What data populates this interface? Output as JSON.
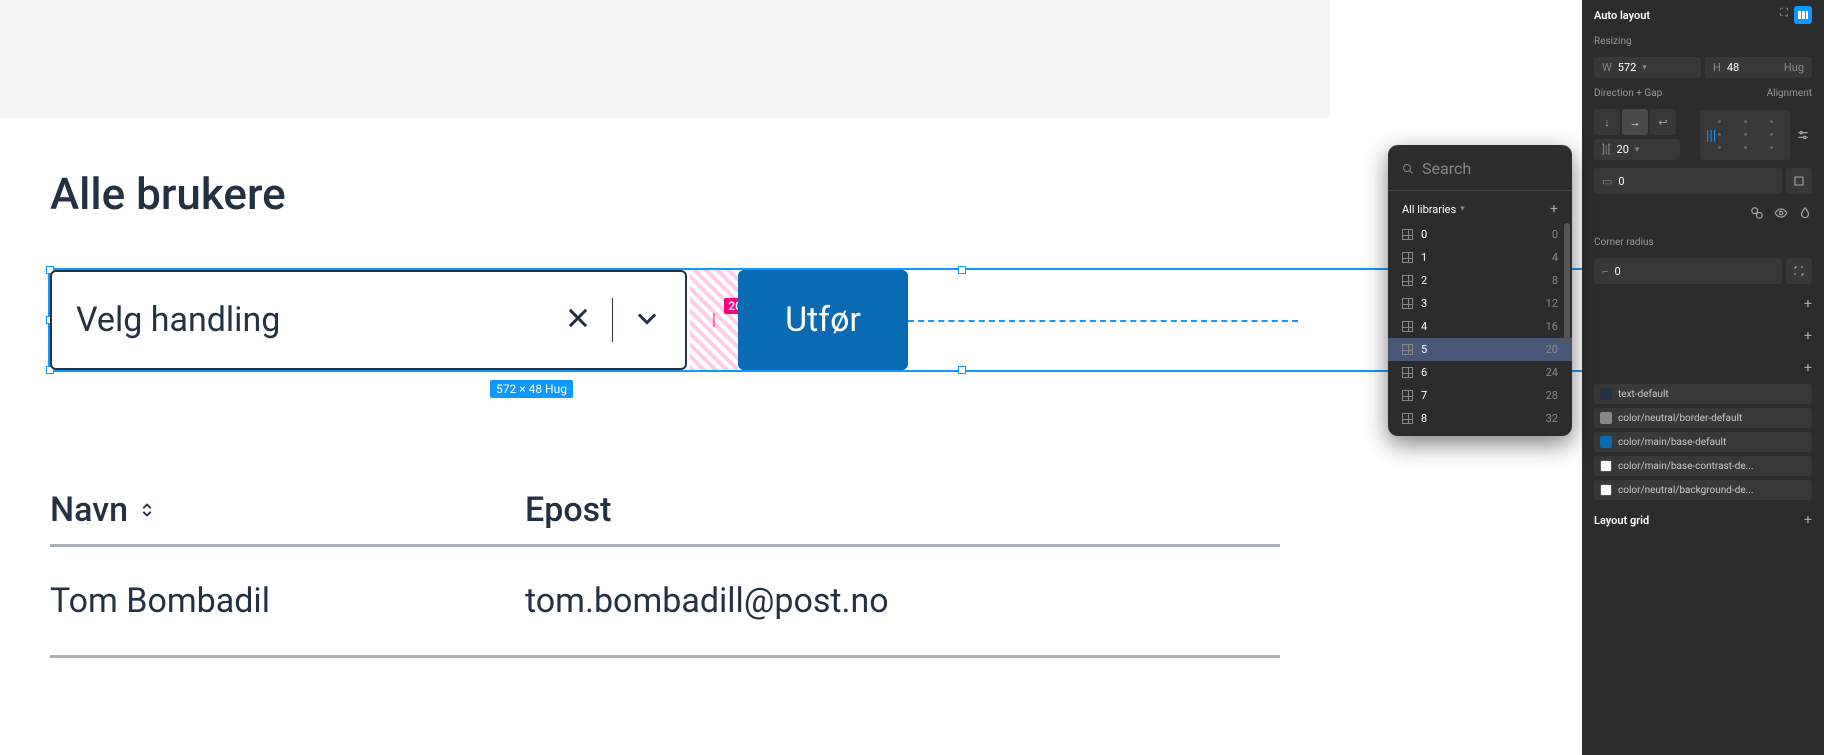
{
  "canvas": {
    "page_title": "Alle brukere",
    "dropdown_label": "Velg handling",
    "spacing_value": "20",
    "exec_button": "Utfør",
    "size_label": "572 × 48 Hug",
    "table": {
      "col_navn": "Navn",
      "col_epost": "Epost",
      "row1_name": "Tom Bombadil",
      "row1_email": "tom.bombadill@post.no"
    }
  },
  "panel": {
    "auto_layout": "Auto layout",
    "resizing": "Resizing",
    "w_label": "W",
    "w_value": "572",
    "h_label": "H",
    "h_value": "48",
    "h_mode": "Hug",
    "direction_gap": "Direction + Gap",
    "alignment": "Alignment",
    "gap_value": "20",
    "padding_value": "0",
    "corner_radius": "Corner radius",
    "corner_value": "0",
    "layout_grid": "Layout grid",
    "colors": {
      "c1": "text-default",
      "c1_hex": "#243142",
      "c2": "color/neutral/border-default",
      "c2_hex": "#888888",
      "c3": "color/main/base-default",
      "c3_hex": "#0a6ab4",
      "c4": "color/main/base-contrast-de...",
      "c4_hex": "#ffffff",
      "c5": "color/neutral/background-de...",
      "c5_hex": "#ffffff"
    }
  },
  "popup": {
    "search": "Search",
    "all_libraries": "All libraries",
    "items": [
      {
        "name": "0",
        "val": "0"
      },
      {
        "name": "1",
        "val": "4"
      },
      {
        "name": "2",
        "val": "8"
      },
      {
        "name": "3",
        "val": "12"
      },
      {
        "name": "4",
        "val": "16"
      },
      {
        "name": "5",
        "val": "20"
      },
      {
        "name": "6",
        "val": "24"
      },
      {
        "name": "7",
        "val": "28"
      },
      {
        "name": "8",
        "val": "32"
      }
    ]
  }
}
